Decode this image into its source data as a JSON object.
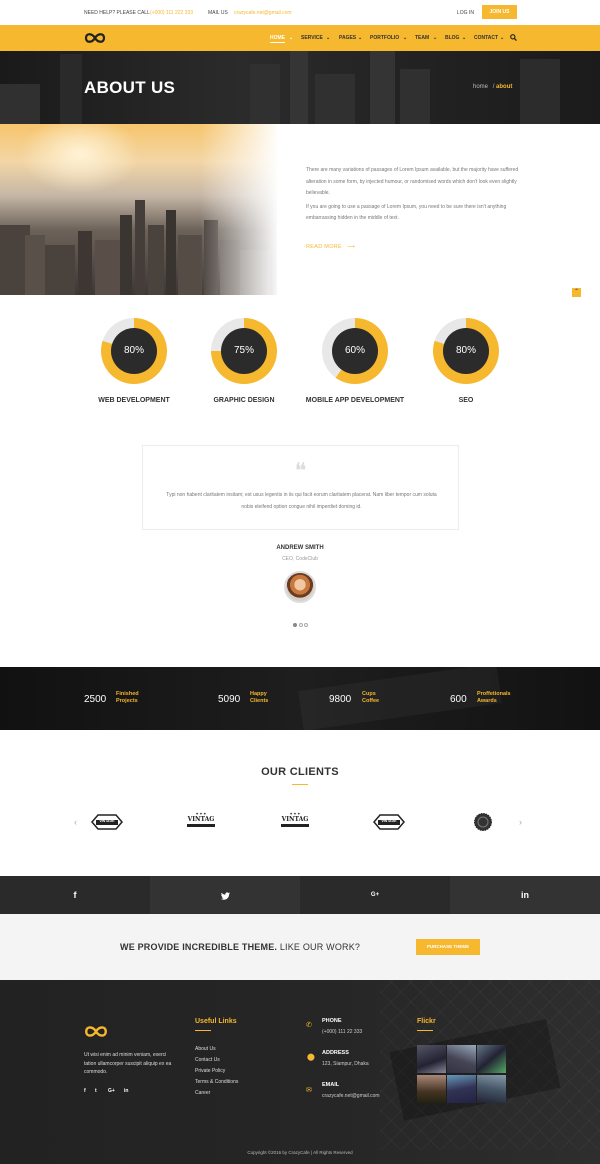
{
  "topbar": {
    "help": "NEED HELP? PLEASE CALL",
    "phone": "(+000) 111 222 333",
    "mail_label": "MAIL US",
    "email": "crazycafe.net@gmail.com",
    "login": "LOG IN",
    "join": "JOIN US"
  },
  "nav": {
    "items": [
      "HOME",
      "SERVICE",
      "PAGES",
      "PORTFOLIO",
      "TEAM",
      "BLOG",
      "CONTACT"
    ],
    "active": "HOME"
  },
  "hero": {
    "title": "ABOUT US",
    "crumb_home": "home",
    "crumb_sep": "/",
    "crumb_current": "about"
  },
  "about": {
    "p1": "There are many variations of passages of Lorem Ipsum available, but the majority have suffered alteration in some form, by injected humour, or randomised words which don't look even slightly believable.",
    "p2": "If you are going to use a passage of Lorem Ipsum, you need to be sure there isn't anything embarrassing hidden in the middle of text.",
    "read_more": "READ MORE"
  },
  "skills": [
    {
      "label": "WEB DEVELOPMENT",
      "value": 80,
      "text": "80%"
    },
    {
      "label": "GRAPHIC DESIGN",
      "value": 75,
      "text": "75%"
    },
    {
      "label": "MOBILE APP DEVELOPMENT",
      "value": 60,
      "text": "60%"
    },
    {
      "label": "SEO",
      "value": 80,
      "text": "80%"
    }
  ],
  "testimonial": {
    "text": "Typi non habent claritatem insitam; est usus legentis in iis qui facit eorum claritatem placerat. Nam liber tempor cum soluta nobis eleifend option congue nihil imperdiet doming id.",
    "author": "ANDREW SMITH",
    "role": "CEO, CodeClub"
  },
  "counters": [
    {
      "num": "2500",
      "l1": "Finished",
      "l2": "Projects"
    },
    {
      "num": "5090",
      "l1": "Happy",
      "l2": "Clients"
    },
    {
      "num": "9800",
      "l1": "Cups",
      "l2": "Coffee"
    },
    {
      "num": "600",
      "l1": "Proffetionals",
      "l2": "Awards"
    }
  ],
  "clients": {
    "title": "OUR CLIENTS",
    "logos": [
      "VINTAGE",
      "VINTAG",
      "VINTAG",
      "VINTAGE",
      ""
    ]
  },
  "social": [
    "f",
    "t",
    "G+",
    "in"
  ],
  "cta": {
    "bold": "WE PROVIDE INCREDIBLE THEME.",
    "rest": " LIKE OUR WORK?",
    "button": "PURCHASE THEME"
  },
  "footer": {
    "about": "Ut wisi enim ad minim veniam, exerci tation ullamcorper suscipit aliquip ex ea commodo.",
    "social": [
      "f",
      "t",
      "G+",
      "in"
    ],
    "links_title": "Useful Links",
    "links": [
      "About Us",
      "Contact Us",
      "Private Policy",
      "Terms & Conditions",
      "Career"
    ],
    "phone_label": "PHONE",
    "phone": "(+000) 111 22 333",
    "address_label": "ADDRESS",
    "address": "123, Siampur, Dhaka",
    "email_label": "EMAIL",
    "email": "crazycafe.net@gmail.com",
    "flickr_title": "Flickr",
    "copyright": "Copyright ©2016 by CrazyCafe  |  All Rights Reserved"
  },
  "colors": {
    "accent": "#f5b82e",
    "dark": "#2b2b2b"
  }
}
